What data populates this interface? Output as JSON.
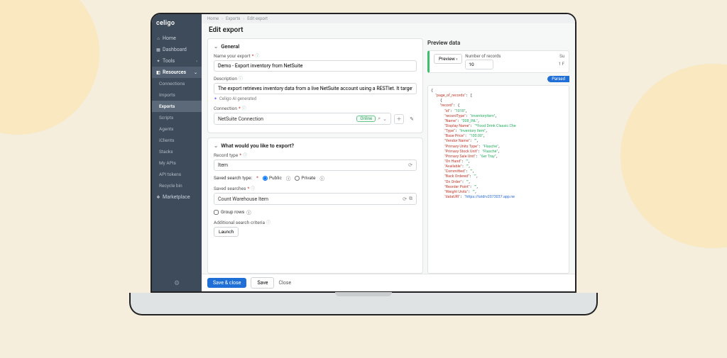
{
  "brand": "celigo",
  "breadcrumb": [
    "Home",
    "Exports",
    "Edit export"
  ],
  "page_title": "Edit export",
  "sidebar": {
    "items": [
      {
        "label": "Home",
        "icon": "⌂"
      },
      {
        "label": "Dashboard",
        "icon": "▦"
      },
      {
        "label": "Tools",
        "icon": "✦",
        "expandable": true
      },
      {
        "label": "Resources",
        "icon": "◧",
        "expandable": true,
        "active": true
      },
      {
        "label": "Marketplace",
        "icon": "❖"
      }
    ],
    "sub_items": [
      {
        "label": "Connections"
      },
      {
        "label": "Imports"
      },
      {
        "label": "Exports",
        "active": true
      },
      {
        "label": "Scripts"
      },
      {
        "label": "Agents"
      },
      {
        "label": "iClients"
      },
      {
        "label": "Stacks"
      },
      {
        "label": "My APIs"
      },
      {
        "label": "API tokens"
      },
      {
        "label": "Recycle bin"
      }
    ]
  },
  "form": {
    "general": {
      "title": "General",
      "name_label": "Name your export",
      "name_value": "Demo - Export inventory from NetSuite",
      "desc_label": "Description",
      "desc_value": "The export retrieves inventory data from a live NetSuite account using a RESTlet. It targets the \"I",
      "ai_label": "Celigo AI generated",
      "conn_label": "Connection",
      "conn_value": "NetSuite Connection",
      "conn_status": "Online"
    },
    "export": {
      "title": "What would you like to export?",
      "record_label": "Record type",
      "record_value": "Item",
      "search_type_label": "Saved search type:",
      "search_type_public": "Public",
      "search_type_private": "Private",
      "saved_search_label": "Saved searches",
      "saved_search_value": "Count Warehouse Item",
      "group_rows_label": "Group rows",
      "criteria_label": "Additional search criteria",
      "launch_btn": "Launch"
    }
  },
  "footer": {
    "save_close": "Save & close",
    "save": "Save",
    "close": "Close"
  },
  "preview": {
    "title": "Preview data",
    "btn": "Preview",
    "num_label": "Number of records",
    "num_value": "10",
    "su": "Su",
    "one_f": "1 F",
    "parsed": "Parsed",
    "json_lines": [
      [
        "{"
      ],
      [
        "  ",
        "\"page_of_records\"",
        ": ["
      ],
      [
        "    {"
      ],
      [
        "    ",
        "\"record\"",
        ": {"
      ],
      [
        "      ",
        "\"id\"",
        ": ",
        "\"1018\"",
        ","
      ],
      [
        "      ",
        "\"recordType\"",
        ": ",
        "\"inventoryitem\"",
        ","
      ],
      [
        "      ",
        "\"Name\"",
        ": ",
        "\"008_INL\"",
        ","
      ],
      [
        "      ",
        "\"Display Name\"",
        ": ",
        "\"*Food Drink Classic Che",
        ""
      ],
      [
        "      ",
        "\"Type\"",
        ": ",
        "\"Inventory Item\"",
        ","
      ],
      [
        "      ",
        "\"Base Price\"",
        ": ",
        "\"100.00\"",
        ","
      ],
      [
        "      ",
        "\"Vendor Name\"",
        ": ",
        "\"\"",
        ","
      ],
      [
        "      ",
        "\"Primary Units Type\"",
        ": ",
        "\"Flasche\"",
        ","
      ],
      [
        "      ",
        "\"Primary Stock Unit\"",
        ": ",
        "\"Flasche\"",
        ","
      ],
      [
        "      ",
        "\"Primary Sale Unit\"",
        ": ",
        "\"6er Tray\"",
        ","
      ],
      [
        "      ",
        "\"On Hand\"",
        ": ",
        "\"\"",
        ","
      ],
      [
        "      ",
        "\"Available\"",
        ": ",
        "\"\"",
        ","
      ],
      [
        "      ",
        "\"Committed\"",
        ": ",
        "\"\"",
        ","
      ],
      [
        "      ",
        "\"Back Ordered\"",
        ": ",
        "\"\"",
        ","
      ],
      [
        "      ",
        "\"On Order\"",
        ": ",
        "\"\"",
        ","
      ],
      [
        "      ",
        "\"Reorder Point\"",
        ": ",
        "\"\"",
        ","
      ],
      [
        "      ",
        "\"Weight Units\"",
        ": ",
        "\"\"",
        ","
      ],
      [
        "      ",
        "\"dataURI\"",
        ": ",
        "\"https://tstdrv2073037.app.ne",
        ""
      ]
    ]
  }
}
